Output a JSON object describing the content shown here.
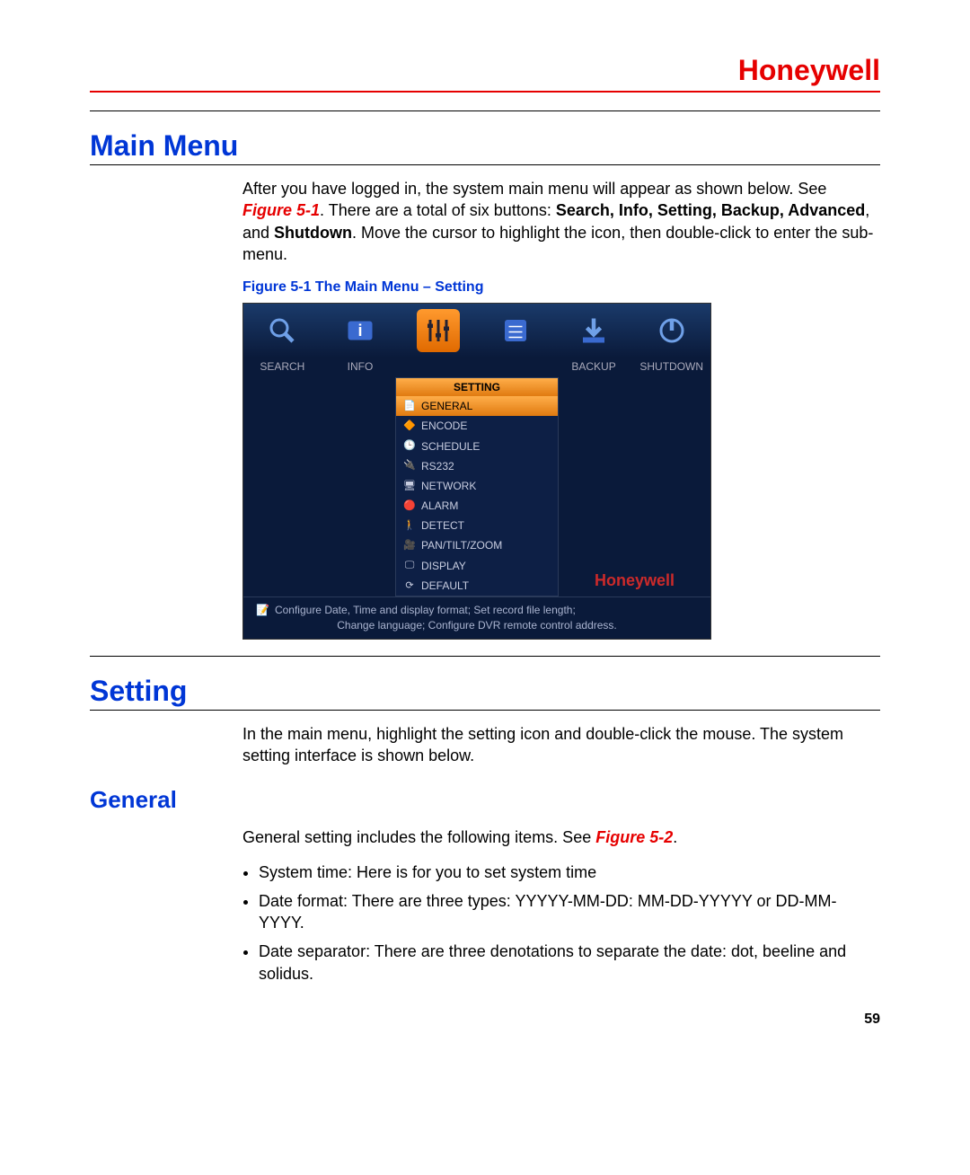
{
  "brand": "Honeywell",
  "page_number": "59",
  "sections": {
    "main_menu": {
      "title": "Main Menu",
      "para_pre": "After you have logged in, the system main menu will appear as shown below. See ",
      "para_figref": "Figure 5-1",
      "para_mid1": ". There are a total of six buttons: ",
      "bold_list": "Search, Info, Setting, Backup, Advanced",
      "para_mid2": ", and ",
      "bold_last": "Shutdown",
      "para_post": ". Move the cursor to highlight the icon, then double-click to enter the sub-menu.",
      "fig_caption": "Figure 5-1 The Main Menu – Setting"
    },
    "setting": {
      "title": "Setting",
      "para": "In the main menu, highlight the setting icon and double-click the mouse. The system setting interface is shown below."
    },
    "general": {
      "title": "General",
      "intro_pre": "General setting includes the following items. See ",
      "intro_figref": "Figure 5-2",
      "intro_post": ".",
      "bullets": [
        "System time: Here is for you to set system time",
        "Date format: There are three types: YYYYY-MM-DD: MM-DD-YYYYY or DD-MM-YYYY.",
        "Date separator: There are three denotations to separate the date: dot, beeline and solidus."
      ]
    }
  },
  "dvr": {
    "toolbar": [
      "SEARCH",
      "INFO",
      "SETTING",
      "ADVANCED",
      "BACKUP",
      "SHUTDOWN"
    ],
    "toolbar_label_row": [
      "SEARCH",
      "INFO",
      "",
      "",
      "BACKUP",
      "SHUTDOWN"
    ],
    "submenu_head": "SETTING",
    "submenu": [
      "GENERAL",
      "ENCODE",
      "SCHEDULE",
      "RS232",
      "NETWORK",
      "ALARM",
      "DETECT",
      "PAN/TILT/ZOOM",
      "DISPLAY",
      "DEFAULT"
    ],
    "brand": "Honeywell",
    "hint1": "Configure Date, Time and display format; Set record file length;",
    "hint2": "Change language; Configure DVR remote control address."
  }
}
